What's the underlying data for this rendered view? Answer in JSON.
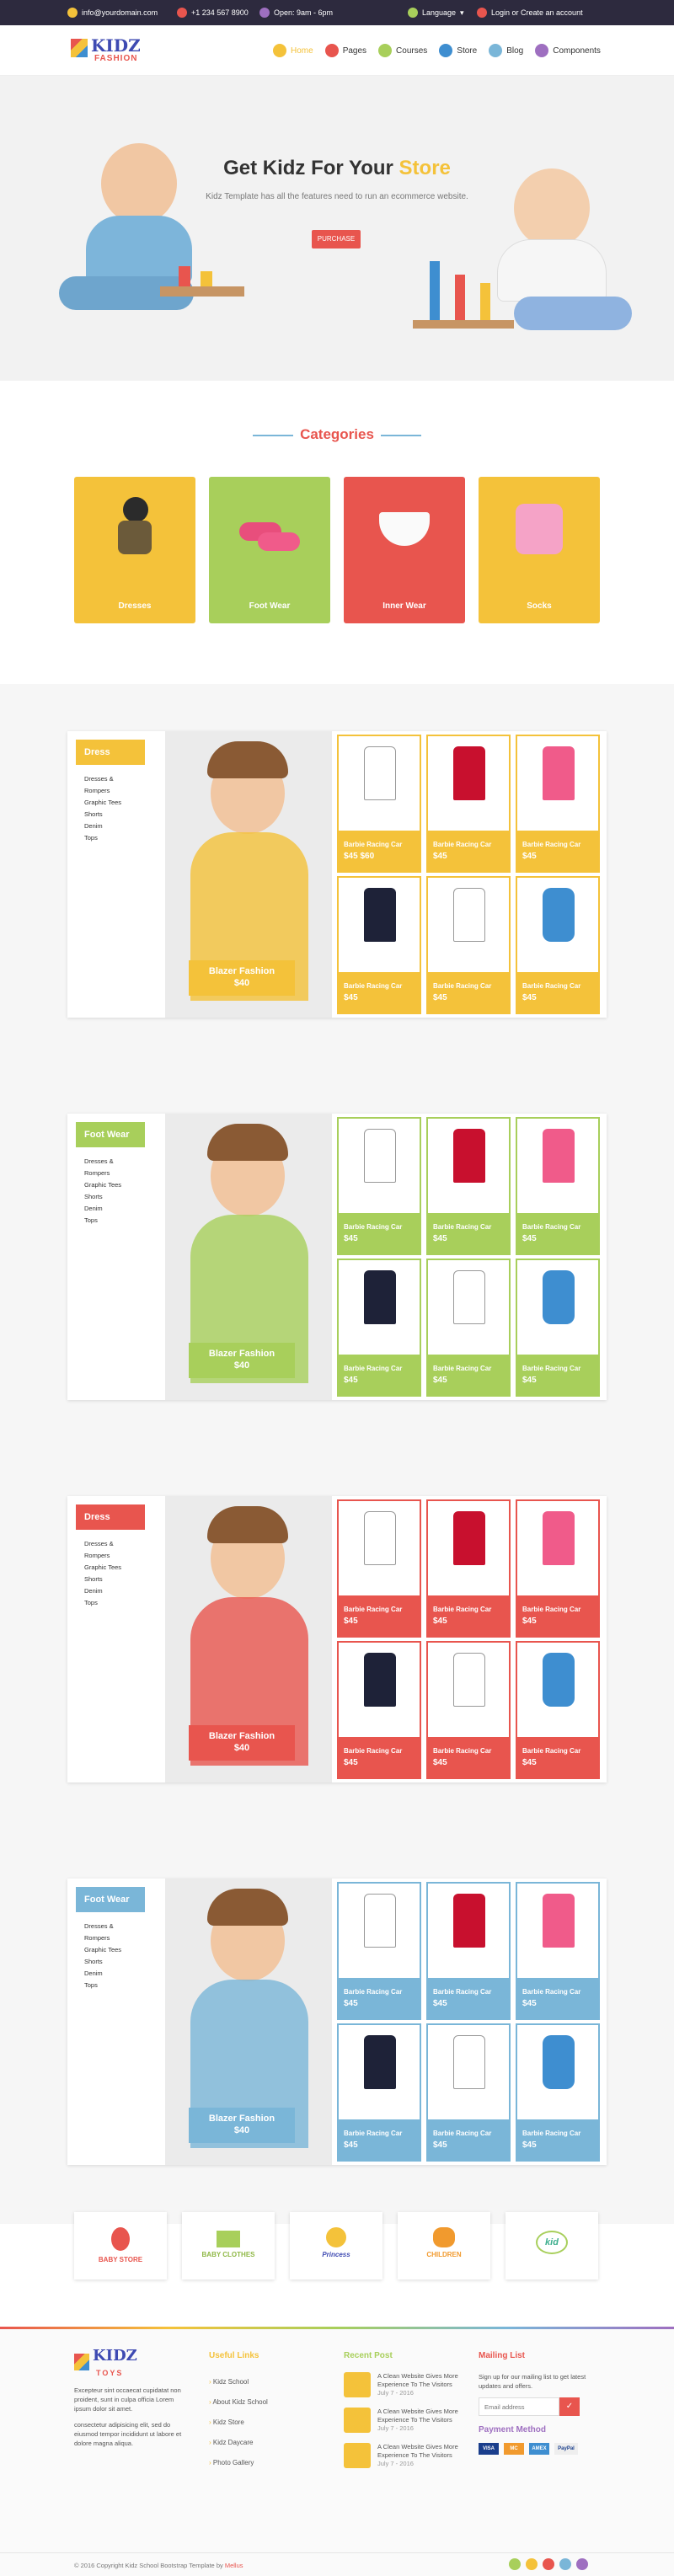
{
  "topbar": {
    "email": "info@yourdomain.com",
    "phone": "+1 234 567 8900",
    "hours": "Open: 9am - 6pm",
    "language": "Language",
    "account": "Login or Create an account"
  },
  "nav": {
    "items": [
      {
        "label": "Home",
        "color": "#f4c23a"
      },
      {
        "label": "Pages",
        "color": "#e8554e"
      },
      {
        "label": "Courses",
        "color": "#a8cf5b"
      },
      {
        "label": "Store",
        "color": "#3e8ed0"
      },
      {
        "label": "Blog",
        "color": "#7ab6d8"
      },
      {
        "label": "Components",
        "color": "#9e6fc0"
      }
    ]
  },
  "logo": {
    "name": "KIDZ",
    "tag": "FASHION"
  },
  "hero": {
    "title_a": "Get Kidz For Your",
    "title_b": "Store",
    "subtitle": "Kidz Template has all the features need to run an ecommerce website.",
    "button": "PURCHASE"
  },
  "categories": {
    "title": "Categories",
    "items": [
      {
        "label": "Dresses",
        "color": "#f4c23a"
      },
      {
        "label": "Foot Wear",
        "color": "#a8cf5b"
      },
      {
        "label": "Inner Wear",
        "color": "#e8554e"
      },
      {
        "label": "Socks",
        "color": "#f4c23a"
      }
    ]
  },
  "sections": [
    {
      "tab": "Dress",
      "color": "#f4c23a",
      "links": [
        "Dresses &",
        "Rompers",
        "Graphic Tees",
        "Shorts",
        "Denim",
        "Tops"
      ],
      "feature_title": "Blazer Fashion",
      "feature_price": "$40",
      "products": [
        {
          "name": "Barbie Racing Car",
          "price": "$45 $60"
        },
        {
          "name": "Barbie Racing Car",
          "price": "$45"
        },
        {
          "name": "Barbie Racing Car",
          "price": "$45"
        },
        {
          "name": "Barbie Racing Car",
          "price": "$45"
        },
        {
          "name": "Barbie Racing Car",
          "price": "$45"
        },
        {
          "name": "Barbie Racing Car",
          "price": "$45"
        }
      ]
    },
    {
      "tab": "Foot Wear",
      "color": "#a8cf5b",
      "links": [
        "Dresses &",
        "Rompers",
        "Graphic Tees",
        "Shorts",
        "Denim",
        "Tops"
      ],
      "feature_title": "Blazer Fashion",
      "feature_price": "$40",
      "products": [
        {
          "name": "Barbie Racing Car",
          "price": "$45"
        },
        {
          "name": "Barbie Racing Car",
          "price": "$45"
        },
        {
          "name": "Barbie Racing Car",
          "price": "$45"
        },
        {
          "name": "Barbie Racing Car",
          "price": "$45"
        },
        {
          "name": "Barbie Racing Car",
          "price": "$45"
        },
        {
          "name": "Barbie Racing Car",
          "price": "$45"
        }
      ]
    },
    {
      "tab": "Dress",
      "color": "#e8554e",
      "links": [
        "Dresses &",
        "Rompers",
        "Graphic Tees",
        "Shorts",
        "Denim",
        "Tops"
      ],
      "feature_title": "Blazer Fashion",
      "feature_price": "$40",
      "products": [
        {
          "name": "Barbie Racing Car",
          "price": "$45"
        },
        {
          "name": "Barbie Racing Car",
          "price": "$45"
        },
        {
          "name": "Barbie Racing Car",
          "price": "$45"
        },
        {
          "name": "Barbie Racing Car",
          "price": "$45"
        },
        {
          "name": "Barbie Racing Car",
          "price": "$45"
        },
        {
          "name": "Barbie Racing Car",
          "price": "$45"
        }
      ]
    },
    {
      "tab": "Foot Wear",
      "color": "#7ab6d8",
      "links": [
        "Dresses &",
        "Rompers",
        "Graphic Tees",
        "Shorts",
        "Denim",
        "Tops"
      ],
      "feature_title": "Blazer Fashion",
      "feature_price": "$40",
      "products": [
        {
          "name": "Barbie Racing Car",
          "price": "$45"
        },
        {
          "name": "Barbie Racing Car",
          "price": "$45"
        },
        {
          "name": "Barbie Racing Car",
          "price": "$45"
        },
        {
          "name": "Barbie Racing Car",
          "price": "$45"
        },
        {
          "name": "Barbie Racing Car",
          "price": "$45"
        },
        {
          "name": "Barbie Racing Car",
          "price": "$45"
        }
      ]
    }
  ],
  "brands": [
    "BABY STORE",
    "BABY CLOTHES",
    "Princess",
    "CHILDREN",
    "kid"
  ],
  "footer": {
    "logo_name": "KIDZ",
    "logo_tag": "TOYS",
    "about1": "Excepteur sint occaecat cupidatat non proident, sunt in culpa officia Lorem ipsum dolor sit amet.",
    "about2": "consectetur adipisicing elit, sed do eiusmod tempor incididunt ut labore et dolore magna aliqua.",
    "useful_title": "Useful Links",
    "useful": [
      "Kidz School",
      "About Kidz School",
      "Kidz Store",
      "Kidz Daycare",
      "Photo Gallery"
    ],
    "recent_title": "Recent Post",
    "recent": [
      {
        "title": "A Clean Website Gives More Experience To The Visitors",
        "date": "July 7 - 2016"
      },
      {
        "title": "A Clean Website Gives More Experience To The Visitors",
        "date": "July 7 - 2016"
      },
      {
        "title": "A Clean Website Gives More Experience To The Visitors",
        "date": "July 7 - 2016"
      }
    ],
    "mailing_title": "Mailing List",
    "mailing_text": "Sign up for our mailing list to get latest updates and offers.",
    "email_placeholder": "Email address",
    "payment_title": "Payment Method",
    "payments": [
      "VISA",
      "MC",
      "AMEX",
      "PayPal"
    ],
    "copyright": "© 2016 Copyright Kidz School Bootstrap Template by ",
    "copyright_by": "Mellus"
  }
}
